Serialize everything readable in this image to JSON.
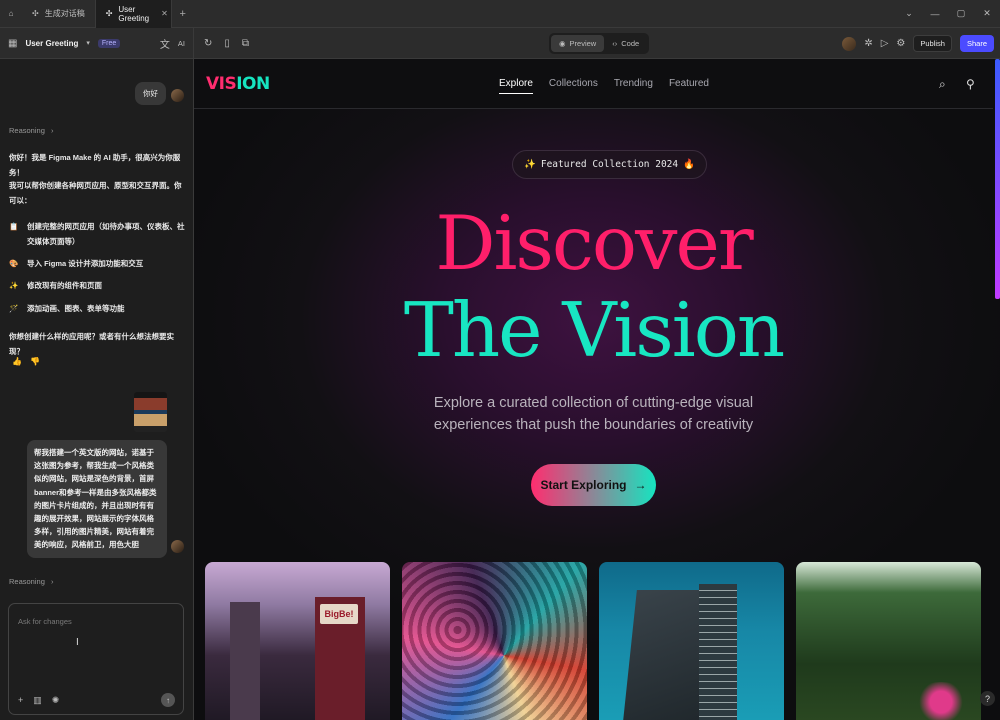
{
  "tabs": [
    {
      "label": "生成对话稿"
    },
    {
      "label": "User Greeting"
    }
  ],
  "toolbar": {
    "project_title": "User Greeting",
    "plan_badge": "Free",
    "ai_label": "AI",
    "preview_label": "Preview",
    "code_label": "Code",
    "publish_label": "Publish",
    "share_label": "Share"
  },
  "chat": {
    "user_greeting": "你好",
    "reasoning_label": "Reasoning",
    "reasoning_chevron": "›",
    "intro": "你好！我是 Figma Make 的 AI 助手，很高兴为你服务！",
    "capabilities_intro": "我可以帮你创建各种网页应用、原型和交互界面。你可以：",
    "items": [
      {
        "icon": "📋",
        "text": "创建完整的网页应用（如待办事项、仪表板、社交媒体页面等）"
      },
      {
        "icon": "🎨",
        "text": "导入 Figma 设计并添加功能和交互"
      },
      {
        "icon": "✨",
        "text": "修改现有的组件和页面"
      },
      {
        "icon": "🪄",
        "text": "添加动画、图表、表单等功能"
      }
    ],
    "question": "你想创建什么样的应用呢？或者有什么想法想要实现？",
    "user_request": "帮我搭建一个英文版的网站，诺基于这张图为参考，帮我生成一个风格类似的网站，网站是深色的背景，首屏banner和参考一样是由多张风格都类的图片卡片组成的，并且出现时有有趣的展开效果，网站展示的字体风格多样，引用的图片精美，网站有着完美的响应，风格前卫，用色大胆",
    "reasoning_label_2": "Reasoning",
    "input_placeholder": "Ask for changes"
  },
  "site": {
    "logo_part1": "VIS",
    "logo_part2": "ION",
    "nav": [
      "Explore",
      "Collections",
      "Trending",
      "Featured"
    ],
    "pill_icon": "✨",
    "pill_text": "Featured Collection 2024",
    "pill_emoji": "🔥",
    "headline_1": "Discover",
    "headline_2": "The Vision",
    "subtitle_1": "Explore a curated collection of cutting-edge visual",
    "subtitle_2": "experiences that push the boundaries of creativity",
    "cta_label": "Start Exploring",
    "cta_arrow": "→",
    "card_sign": "BigBe!"
  },
  "colors": {
    "accent_pink": "#ff1f6a",
    "accent_teal": "#18e6c2",
    "share_blue": "#4b4bff"
  }
}
